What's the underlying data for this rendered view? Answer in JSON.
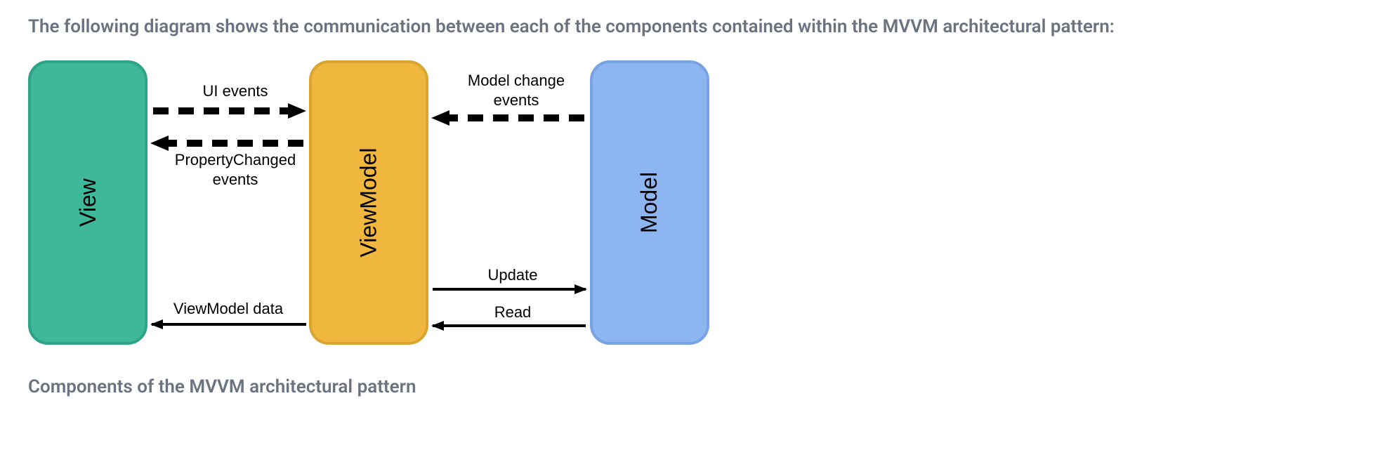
{
  "intro_text": "The following diagram shows the communication between each of the components contained within the MVVM architectural pattern:",
  "caption_text": "Components of the MVVM architectural pattern",
  "boxes": {
    "view": "View",
    "viewmodel": "ViewModel",
    "model": "Model"
  },
  "arrows": {
    "ui_events": "UI events",
    "property_changed": "PropertyChanged\nevents",
    "viewmodel_data": "ViewModel data",
    "model_change": "Model change\nevents",
    "update": "Update",
    "read": "Read"
  },
  "colors": {
    "view_fill": "#3eb79b",
    "view_stroke": "#2fa387",
    "vm_fill": "#efb73e",
    "vm_stroke": "#d9a530",
    "model_fill": "#8db6f1",
    "model_stroke": "#78a3e3",
    "text_gray": "#6b7280"
  }
}
